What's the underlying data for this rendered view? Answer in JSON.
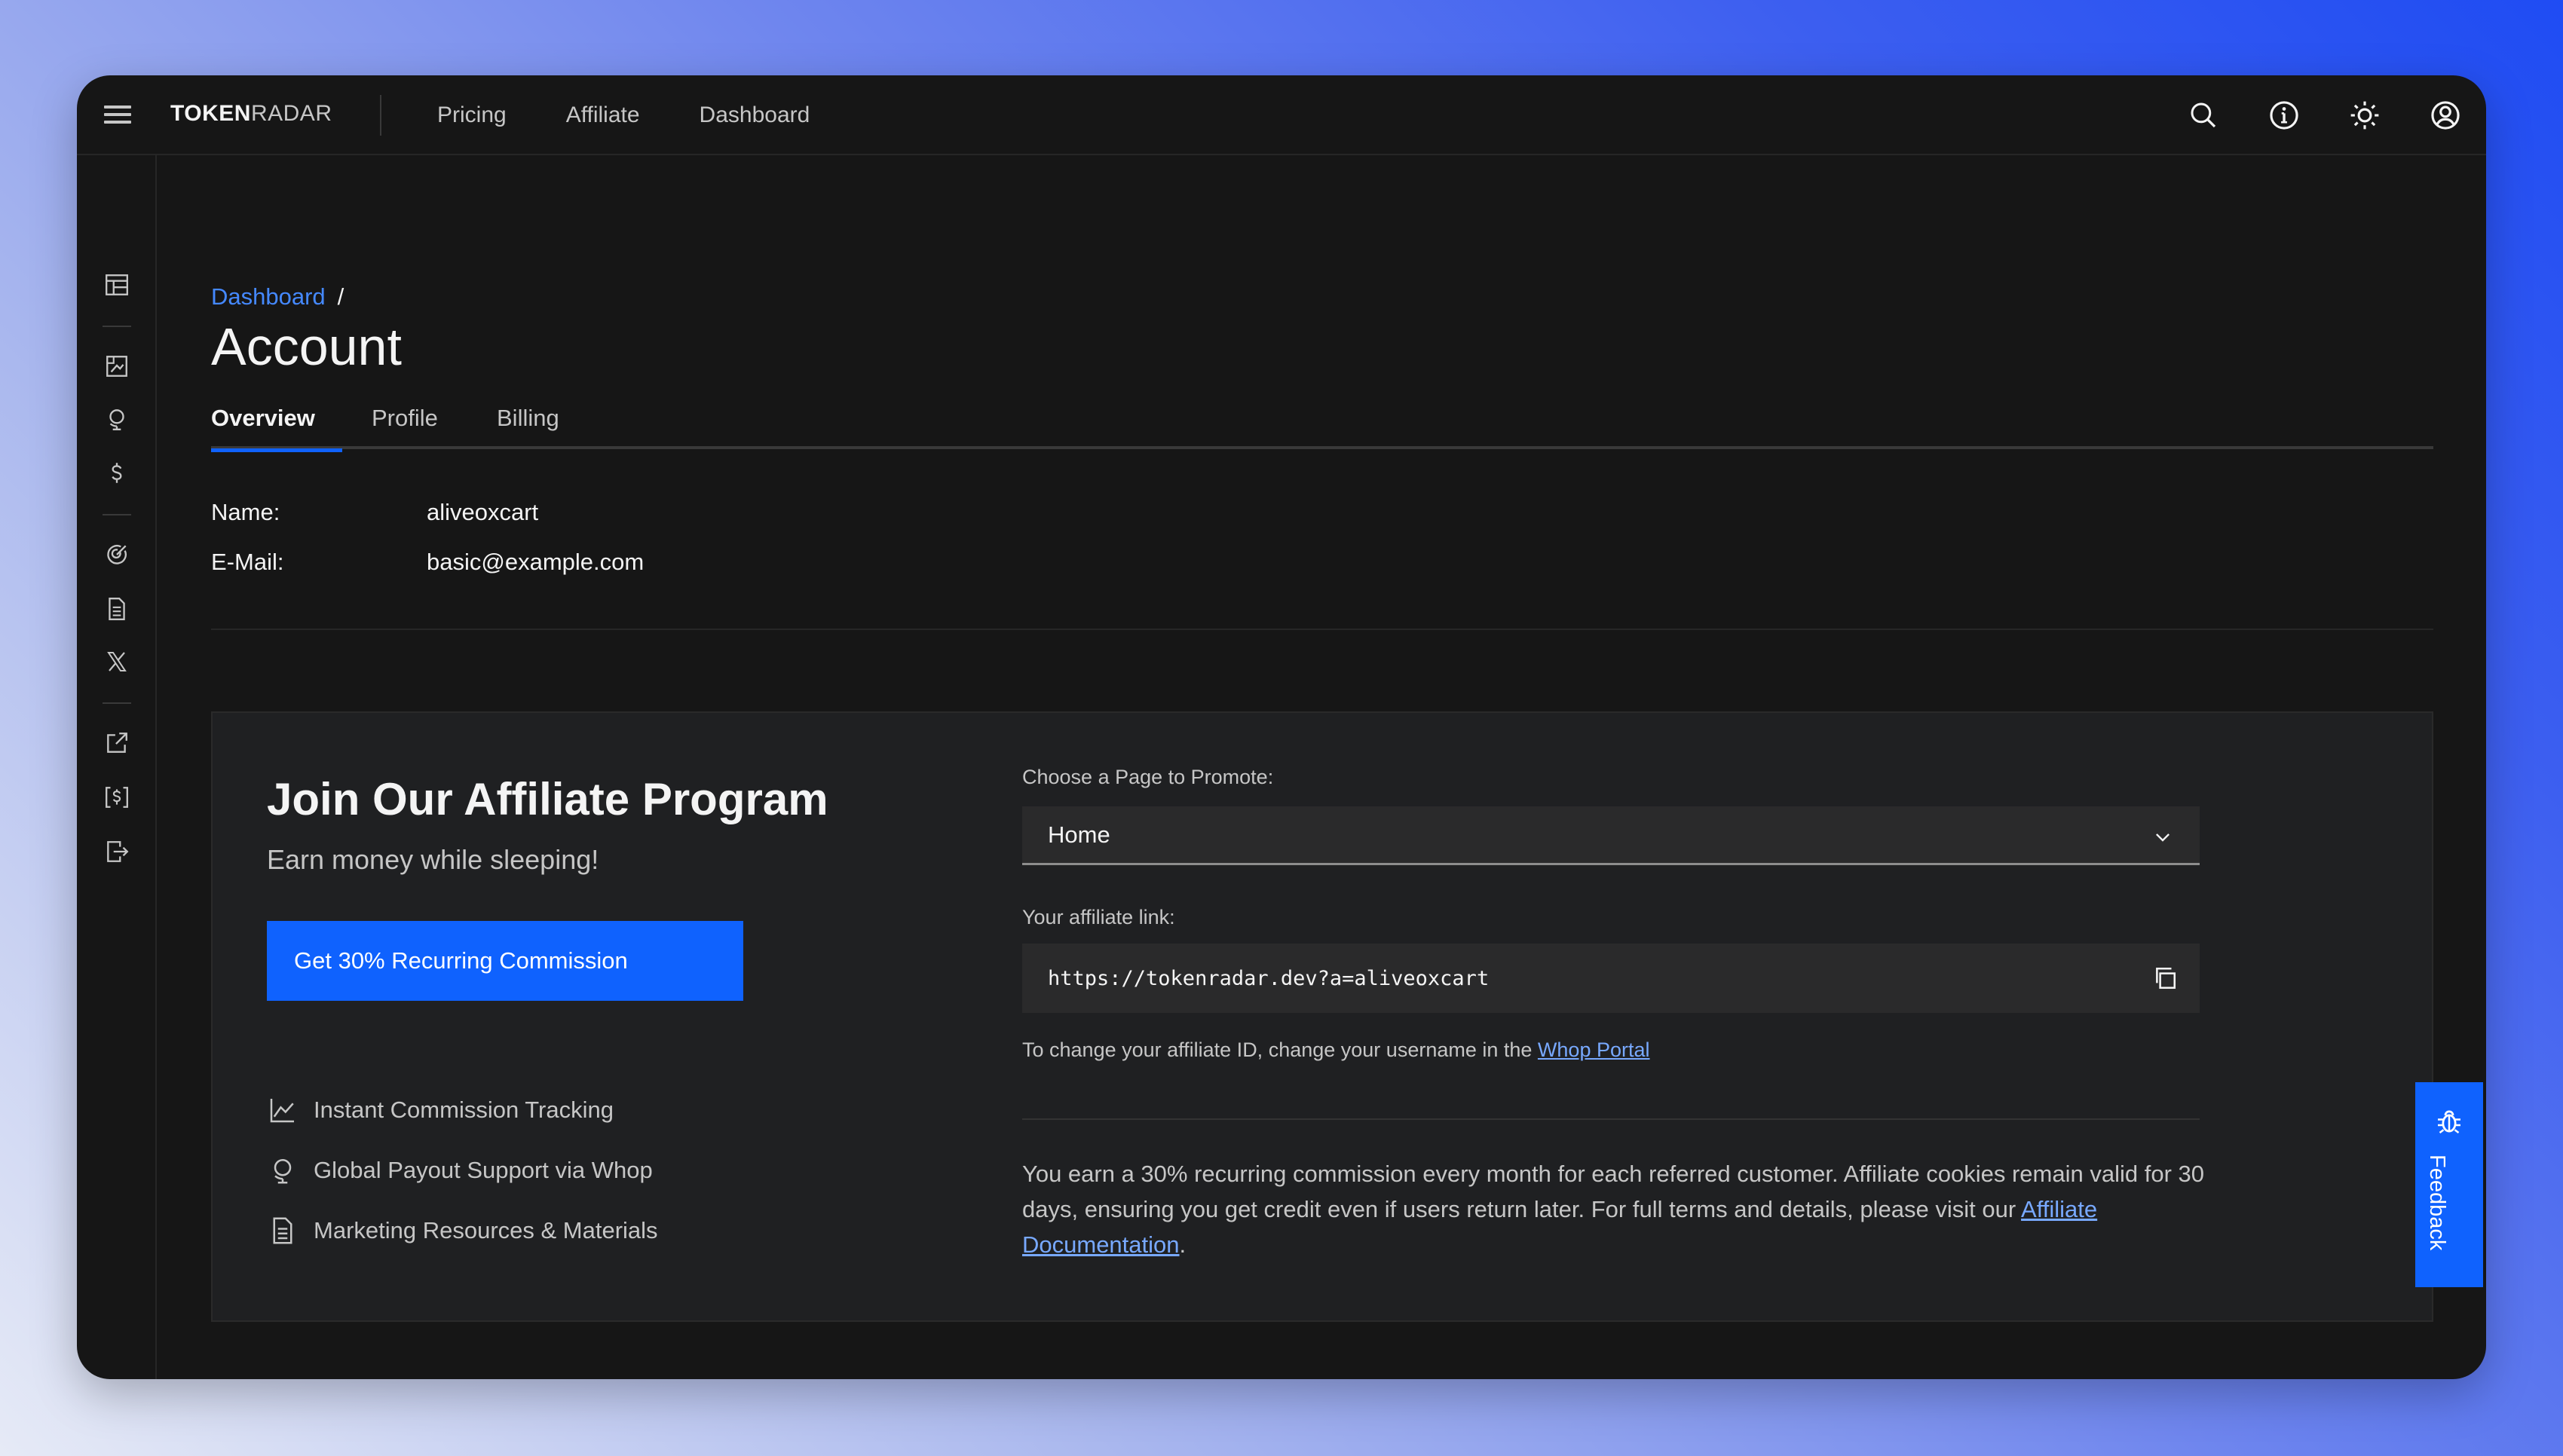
{
  "app": {
    "logo_bold": "TOKEN",
    "logo_rest": "RADAR"
  },
  "topnav": {
    "items": [
      "Pricing",
      "Affiliate",
      "Dashboard"
    ],
    "icons": [
      "search-icon",
      "info-icon",
      "theme-toggle-icon",
      "user-avatar-icon"
    ]
  },
  "sidebar": {
    "icons": [
      "dashboard-icon",
      "chart-icon",
      "globe-icon",
      "dollar-icon",
      "target-icon",
      "document-icon",
      "x-logo-icon",
      "external-link-icon",
      "currency-bracket-icon",
      "logout-icon"
    ]
  },
  "breadcrumb": {
    "root": "Dashboard",
    "separator": "/"
  },
  "page": {
    "title": "Account",
    "tabs": [
      {
        "label": "Overview",
        "active": true
      },
      {
        "label": "Profile",
        "active": false
      },
      {
        "label": "Billing",
        "active": false
      }
    ]
  },
  "account": {
    "name_label": "Name:",
    "name_value": "aliveoxcart",
    "email_label": "E-Mail:",
    "email_value": "basic@example.com"
  },
  "affiliate": {
    "title": "Join Our Affiliate Program",
    "subtitle": "Earn money while sleeping!",
    "cta_label": "Get 30% Recurring Commission",
    "features": [
      {
        "icon": "chart-line-icon",
        "label": "Instant Commission Tracking"
      },
      {
        "icon": "globe-icon",
        "label": "Global Payout Support via Whop"
      },
      {
        "icon": "document-icon",
        "label": "Marketing Resources & Materials"
      }
    ],
    "page_select_label": "Choose a Page to Promote:",
    "page_select_value": "Home",
    "link_label": "Your affiliate link:",
    "link_value": "https://tokenradar.dev?a=aliveoxcart",
    "helper_text": "To change your affiliate ID, change your username in the ",
    "helper_link": "Whop Portal",
    "terms_text": "You earn a 30% recurring commission every month for each referred customer. Affiliate cookies remain valid for 30 days, ensuring you get credit even if users return later. For full terms and details, please visit our ",
    "terms_link": "Affiliate Documentation",
    "terms_end": "."
  },
  "feedback": {
    "label": "Feedback"
  },
  "colors": {
    "accent": "#0f62fe",
    "link": "#4589ff",
    "window_bg": "#161616",
    "card_bg": "#1f2022"
  }
}
